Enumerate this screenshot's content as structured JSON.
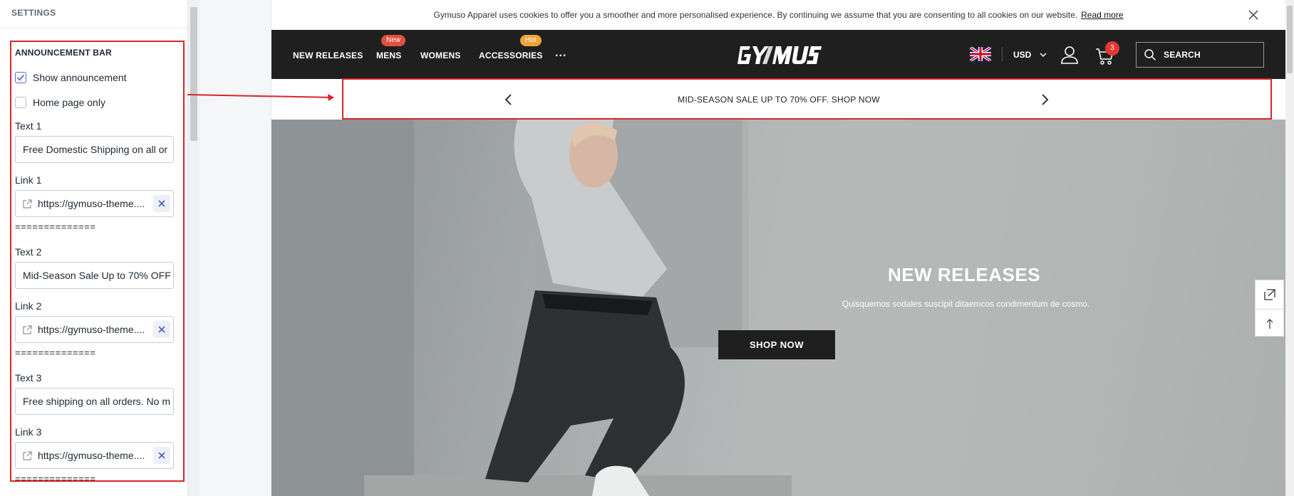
{
  "panel": {
    "header": "SETTINGS",
    "section_title": "ANNOUNCEMENT BAR",
    "show_announcement": {
      "label": "Show announcement",
      "checked": true
    },
    "home_page_only": {
      "label": "Home page only",
      "checked": false
    },
    "fields": [
      {
        "text_label": "Text 1",
        "text_value": "Free Domestic Shipping on all or",
        "link_label": "Link 1",
        "link_value": "https://gymuso-theme....",
        "divider": "=============="
      },
      {
        "text_label": "Text 2",
        "text_value": "Mid-Season Sale Up to 70% OFF",
        "link_label": "Link 2",
        "link_value": "https://gymuso-theme....",
        "divider": "=============="
      },
      {
        "text_label": "Text 3",
        "text_value": "Free shipping on all orders. No m",
        "link_label": "Link 3",
        "link_value": "https://gymuso-theme....",
        "divider": "=============="
      }
    ]
  },
  "store": {
    "cookie_text": "Gymuso Apparel uses cookies to offer you a smoother and more personalised experience. By continuing we assume that you are consenting to all cookies on our website.",
    "cookie_link": "Read more",
    "nav": {
      "items": [
        "NEW RELEASES",
        "MENS",
        "WOMENS",
        "ACCESSORIES"
      ],
      "more": "...",
      "badges": {
        "mens": "New",
        "accessories": "Hot"
      },
      "badge_colors": {
        "new": "#e0513d",
        "hot": "#f0a23a"
      },
      "currency": "USD",
      "cart_count": "3",
      "search_label": "SEARCH"
    },
    "announcement": "MID-SEASON SALE UP TO 70% OFF. SHOP NOW",
    "hero": {
      "title": "NEW RELEASES",
      "subtitle": "Quisquemos sodales suscipit ditaemcos condimentum de cosmo.",
      "button": "SHOP NOW"
    }
  },
  "colors": {
    "highlight": "#d9252b",
    "nav_bg": "#1f1f1f",
    "checkbox_accent": "#5c6ac4"
  },
  "icons": [
    "checkmark-icon",
    "external-link-icon",
    "close-icon",
    "chevron-left-icon",
    "chevron-right-icon",
    "user-icon",
    "cart-icon",
    "search-icon",
    "chevron-down-icon",
    "uk-flag-icon",
    "expand-icon",
    "arrow-up-icon"
  ]
}
